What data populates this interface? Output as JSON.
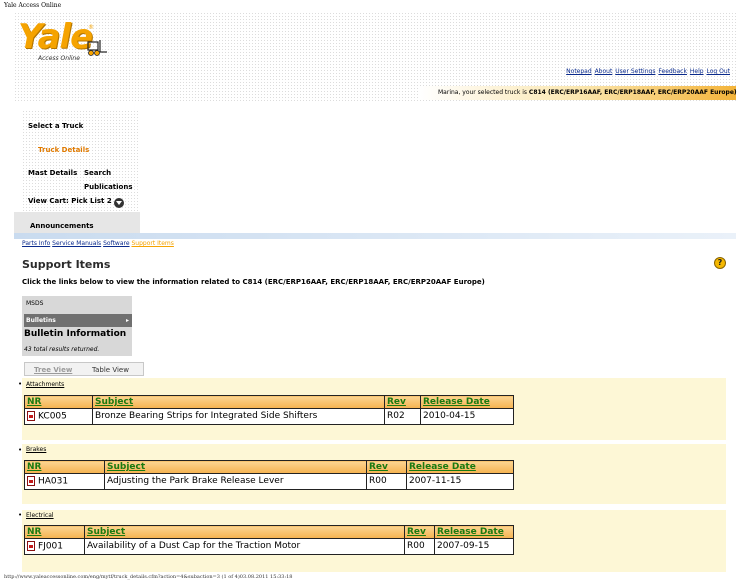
{
  "window": {
    "title": "Yale Access Online"
  },
  "brand": {
    "logo_text": "Yale",
    "logo_reg": "®",
    "logo_sub": "Access Online"
  },
  "top_links": [
    "Notepad",
    "About",
    "User Settings",
    "Feedback",
    "Help",
    "Log Out"
  ],
  "truck_bar": {
    "prefix": "Marina, your selected truck is ",
    "truck": "C814 (ERC/ERP16AAF, ERC/ERP18AAF, ERC/ERP20AAF Europe)"
  },
  "left_nav": {
    "select_truck": "Select a Truck",
    "truck_details": "Truck Details",
    "mast_details": "Mast Details",
    "search": "Search",
    "publications": "Publications",
    "view_cart": "View Cart: Pick List 2",
    "announcements": "Announcements"
  },
  "sub_nav": [
    "Parts Info",
    "Service Manuals",
    "Software",
    "Support Items"
  ],
  "main": {
    "heading": "Support Items",
    "help_glyph": "?",
    "intro": "Click the links below to view the information related to C814 (ERC/ERP16AAF, ERC/ERP18AAF, ERC/ERP20AAF Europe)",
    "menu": {
      "msds": "MSDS",
      "bulletins": "Bulletins",
      "arrow": "▸"
    },
    "bulletin_title": "Bulletin Information",
    "results": "43 total results returned.",
    "tabs": {
      "tree": "Tree View",
      "table": "Table View"
    },
    "columns": [
      "NR",
      "Subject",
      "Rev",
      "Release Date"
    ],
    "categories": [
      {
        "name": "Attachments",
        "rows": [
          {
            "nr": "KC005",
            "subject": "Bronze Bearing Strips for Integrated Side Shifters",
            "rev": "R02",
            "date": "2010-04-15"
          }
        ]
      },
      {
        "name": "Brakes",
        "rows": [
          {
            "nr": "HA031",
            "subject": "Adjusting the Park Brake Release Lever",
            "rev": "R00",
            "date": "2007-11-15"
          }
        ]
      },
      {
        "name": "Electrical",
        "rows": [
          {
            "nr": "FJ001",
            "subject": "Availability of a Dust Cap for the Traction Motor",
            "rev": "R00",
            "date": "2007-09-15"
          }
        ]
      }
    ]
  },
  "footer": "http://www.yaleaccessonline.com/eng/mytf/truck_details.cfm?action=4&subaction=3 (1 of 4)03.08.2011 15:33:18"
}
